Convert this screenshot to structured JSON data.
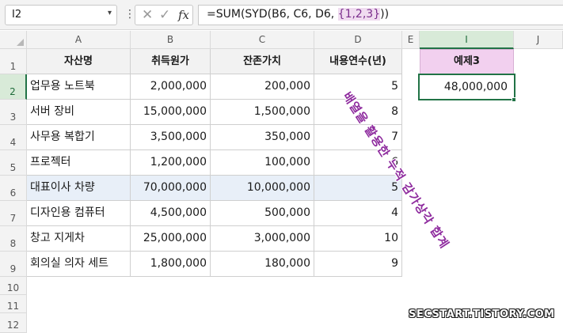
{
  "formula_bar": {
    "name_box": "I2",
    "fx_label": "fx",
    "formula_before": "=SUM(SYD(B6, C6, D6, ",
    "formula_highlight": "{1,2,3}",
    "formula_after": "))"
  },
  "columns": [
    "A",
    "B",
    "C",
    "D",
    "E",
    "I",
    "J"
  ],
  "rows": [
    "1",
    "2",
    "3",
    "4",
    "5",
    "6",
    "7",
    "8",
    "9",
    "10",
    "11",
    "12"
  ],
  "table": {
    "headers": [
      "자산명",
      "취득원가",
      "잔존가치",
      "내용연수(년)"
    ],
    "rows": [
      [
        "업무용 노트북",
        "2,000,000",
        "200,000",
        "5"
      ],
      [
        "서버 장비",
        "15,000,000",
        "1,500,000",
        "8"
      ],
      [
        "사무용 복합기",
        "3,500,000",
        "350,000",
        "7"
      ],
      [
        "프로젝터",
        "1,200,000",
        "100,000",
        "6"
      ],
      [
        "대표이사 차량",
        "70,000,000",
        "10,000,000",
        "5"
      ],
      [
        "디자인용 컴퓨터",
        "4,500,000",
        "500,000",
        "4"
      ],
      [
        "창고 지게차",
        "25,000,000",
        "3,000,000",
        "10"
      ],
      [
        "회의실 의자 세트",
        "1,800,000",
        "180,000",
        "9"
      ]
    ]
  },
  "example": {
    "header": "예제3",
    "value": "48,000,000"
  },
  "annotation": "배열을 활용한 누적 감가상각 합계",
  "watermark": "SECSTART.TISTORY.COM",
  "colors": {
    "accent": "#217346",
    "example_header_bg": "#f2d0ef",
    "highlight_row_bg": "#e8eff8",
    "annotation_text": "#8e2b9e"
  },
  "icons": [
    "cancel-icon",
    "enter-check-icon",
    "insert-function-icon",
    "more-options-icon",
    "chevron-down-icon"
  ]
}
